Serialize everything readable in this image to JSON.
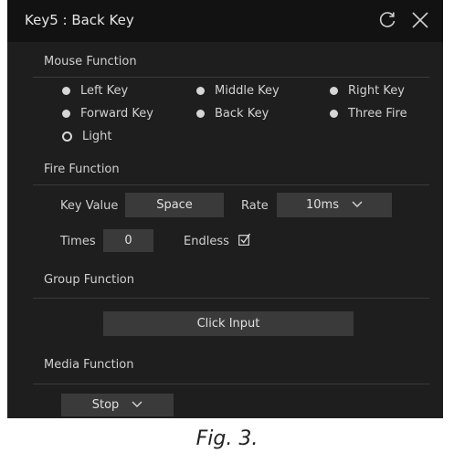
{
  "window": {
    "title": "Key5 : Back Key"
  },
  "mouse_function": {
    "title": "Mouse Function",
    "options": [
      "Left Key",
      "Middle Key",
      "Right Key",
      "Forward Key",
      "Back Key",
      "Three Fire",
      "Light"
    ],
    "selected": "Light"
  },
  "fire_function": {
    "title": "Fire Function",
    "key_value_label": "Key Value",
    "key_value": "Space",
    "rate_label": "Rate",
    "rate_value": "10ms",
    "times_label": "Times",
    "times_value": "0",
    "endless_label": "Endless"
  },
  "group_function": {
    "title": "Group Function",
    "button_label": "Click Input"
  },
  "media_function": {
    "title": "Media Function",
    "selected": "Stop"
  },
  "caption": "Fig. 3."
}
